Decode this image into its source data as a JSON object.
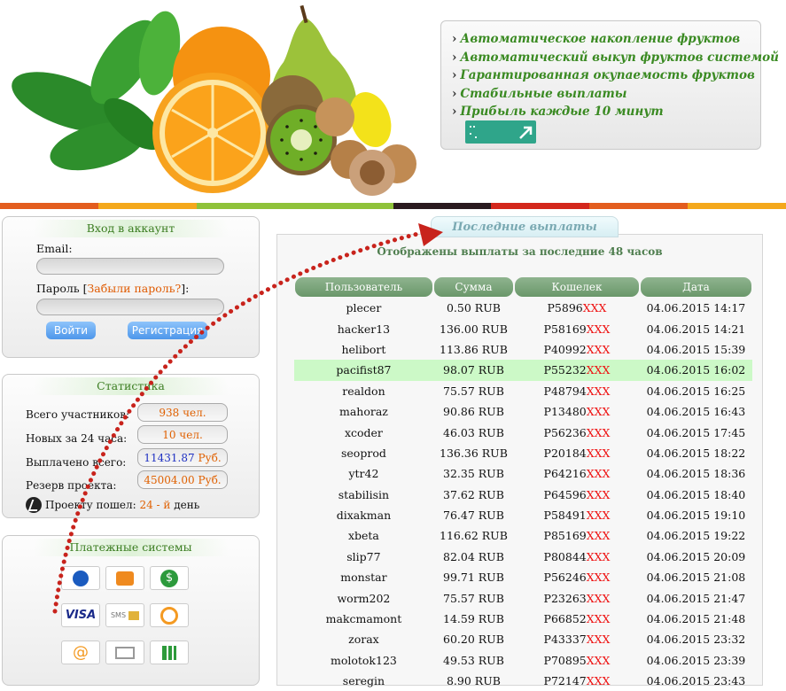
{
  "header": {
    "features": [
      "Автоматическое накопление фруктов",
      "Автоматический выкуп фруктов системой",
      "Гарантированная окупаемость фруктов",
      "Стабильные выплаты",
      "Прибыль каждые 10 минут"
    ],
    "color_bar": [
      "#e35d1e",
      "#f4a81c",
      "#8fc23a",
      "#8fc23a",
      "#2a1a1f",
      "#d3271c",
      "#e35d1e",
      "#f4a81c"
    ]
  },
  "login": {
    "title": "Вход в аккаунт",
    "email_label": "Email:",
    "password_label": "Пароль",
    "forgot_link": "Забыли пароль?",
    "bracket_open": "[",
    "bracket_close": "]:",
    "login_button": "Войти",
    "register_button": "Регистрация"
  },
  "stats": {
    "title": "Статистика",
    "rows": [
      {
        "label": "Всего участников:",
        "value": "938 чел."
      },
      {
        "label": "Новых за 24 часа:",
        "value": "10 чел."
      },
      {
        "label": "Выплачено всего:",
        "value_num": "11431.87",
        "value_unit": "Руб."
      },
      {
        "label": "Резерв проекта:",
        "value": "45004.00 Руб."
      }
    ],
    "days_prefix": "Проекту пошел:",
    "days_value": "24 - й",
    "days_suffix": "день"
  },
  "payments": {
    "title": "Платежные системы",
    "icons": [
      "webmoney-icon",
      "qiwi-wallet-icon",
      "money-icon",
      "visa-icon",
      "sms-icon",
      "qiwi-icon",
      "email-money-icon",
      "envelope-icon",
      "payment-icon"
    ],
    "visa_text": "VISA",
    "sms_text": "SMS"
  },
  "payouts": {
    "tab": "Последние выплаты",
    "subtitle": "Отображены выплаты за последние 48 часов",
    "columns": [
      "Пользователь",
      "Сумма",
      "Кошелек",
      "Дата"
    ],
    "rows": [
      {
        "user": "plecer",
        "amount": "0.50 RUB",
        "wallet": "P5896",
        "mask": "XXX",
        "date": "04.06.2015 14:17"
      },
      {
        "user": "hacker13",
        "amount": "136.00 RUB",
        "wallet": "P58169",
        "mask": "XXX",
        "date": "04.06.2015 14:21"
      },
      {
        "user": "helibort",
        "amount": "113.86 RUB",
        "wallet": "P40992",
        "mask": "XXX",
        "date": "04.06.2015 15:39"
      },
      {
        "user": "pacifist87",
        "amount": "98.07 RUB",
        "wallet": "P55232",
        "mask": "XXX",
        "date": "04.06.2015 16:02"
      },
      {
        "user": "realdon",
        "amount": "75.57 RUB",
        "wallet": "P48794",
        "mask": "XXX",
        "date": "04.06.2015 16:25"
      },
      {
        "user": "mahoraz",
        "amount": "90.86 RUB",
        "wallet": "P13480",
        "mask": "XXX",
        "date": "04.06.2015 16:43"
      },
      {
        "user": "xcoder",
        "amount": "46.03 RUB",
        "wallet": "P56236",
        "mask": "XXX",
        "date": "04.06.2015 17:45"
      },
      {
        "user": "seoprod",
        "amount": "136.36 RUB",
        "wallet": "P20184",
        "mask": "XXX",
        "date": "04.06.2015 18:22"
      },
      {
        "user": "ytr42",
        "amount": "32.35 RUB",
        "wallet": "P64216",
        "mask": "XXX",
        "date": "04.06.2015 18:36"
      },
      {
        "user": "stabilisin",
        "amount": "37.62 RUB",
        "wallet": "P64596",
        "mask": "XXX",
        "date": "04.06.2015 18:40"
      },
      {
        "user": "dixakman",
        "amount": "76.47 RUB",
        "wallet": "P58491",
        "mask": "XXX",
        "date": "04.06.2015 19:10"
      },
      {
        "user": "xbeta",
        "amount": "116.62 RUB",
        "wallet": "P85169",
        "mask": "XXX",
        "date": "04.06.2015 19:22"
      },
      {
        "user": "slip77",
        "amount": "82.04 RUB",
        "wallet": "P80844",
        "mask": "XXX",
        "date": "04.06.2015 20:09"
      },
      {
        "user": "monstar",
        "amount": "99.71 RUB",
        "wallet": "P56246",
        "mask": "XXX",
        "date": "04.06.2015 21:08"
      },
      {
        "user": "worm202",
        "amount": "75.57 RUB",
        "wallet": "P23263",
        "mask": "XXX",
        "date": "04.06.2015 21:47"
      },
      {
        "user": "makcmamont",
        "amount": "14.59 RUB",
        "wallet": "P66852",
        "mask": "XXX",
        "date": "04.06.2015 21:48"
      },
      {
        "user": "zorax",
        "amount": "60.20 RUB",
        "wallet": "P43337",
        "mask": "XXX",
        "date": "04.06.2015 23:32"
      },
      {
        "user": "molotok123",
        "amount": "49.53 RUB",
        "wallet": "P70895",
        "mask": "XXX",
        "date": "04.06.2015 23:39"
      },
      {
        "user": "seregin",
        "amount": "8.90 RUB",
        "wallet": "P72147",
        "mask": "XXX",
        "date": "04.06.2015 23:43"
      }
    ],
    "highlighted_row": 3
  }
}
